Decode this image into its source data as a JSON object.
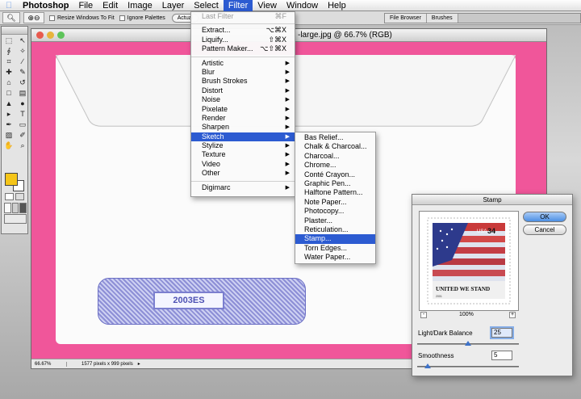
{
  "menubar": {
    "app": "Photoshop",
    "items": [
      "File",
      "Edit",
      "Image",
      "Layer",
      "Select",
      "Filter",
      "View",
      "Window",
      "Help"
    ],
    "active": "Filter"
  },
  "options": {
    "chk1": "Resize Windows To Fit",
    "chk2": "Ignore Palettes",
    "pill1": "Actual",
    "tabs": [
      "File Browser",
      "Brushes"
    ]
  },
  "toolbox": {
    "foreground": "#f5c518",
    "background": "#ffffff"
  },
  "document": {
    "title": "-large.jpg @ 66.7% (RGB)",
    "zoom": "66.67%",
    "size": "1577 pixels x 999 pixels",
    "canvas_color": "#f0569a",
    "envelope_code": "2003ES"
  },
  "filter_menu": {
    "items": [
      {
        "label": "Last Filter",
        "shortcut": "⌘F",
        "disabled": true
      },
      {
        "sep": true
      },
      {
        "label": "Extract...",
        "shortcut": "⌥⌘X"
      },
      {
        "label": "Liquify...",
        "shortcut": "⇧⌘X"
      },
      {
        "label": "Pattern Maker...",
        "shortcut": "⌥⇧⌘X"
      },
      {
        "sep": true
      },
      {
        "label": "Artistic",
        "sub": true
      },
      {
        "label": "Blur",
        "sub": true
      },
      {
        "label": "Brush Strokes",
        "sub": true
      },
      {
        "label": "Distort",
        "sub": true
      },
      {
        "label": "Noise",
        "sub": true
      },
      {
        "label": "Pixelate",
        "sub": true
      },
      {
        "label": "Render",
        "sub": true
      },
      {
        "label": "Sharpen",
        "sub": true
      },
      {
        "label": "Sketch",
        "sub": true,
        "highlight": true
      },
      {
        "label": "Stylize",
        "sub": true
      },
      {
        "label": "Texture",
        "sub": true
      },
      {
        "label": "Video",
        "sub": true
      },
      {
        "label": "Other",
        "sub": true
      },
      {
        "sep": true
      },
      {
        "label": "Digimarc",
        "sub": true
      }
    ]
  },
  "sketch_menu": {
    "items": [
      "Bas Relief...",
      "Chalk & Charcoal...",
      "Charcoal...",
      "Chrome...",
      "Conté Crayon...",
      "Graphic Pen...",
      "Halftone Pattern...",
      "Note Paper...",
      "Photocopy...",
      "Plaster...",
      "Reticulation...",
      "Stamp...",
      "Torn Edges...",
      "Water Paper..."
    ],
    "highlighted": "Stamp..."
  },
  "dialog": {
    "title": "Stamp",
    "ok": "OK",
    "cancel": "Cancel",
    "zoom": "100%",
    "zoom_minus": "-",
    "zoom_plus": "+",
    "light_dark_label": "Light/Dark Balance",
    "light_dark_value": "25",
    "light_dark_max": 50,
    "smoothness_label": "Smoothness",
    "smoothness_value": "5",
    "smoothness_max": 50,
    "stamp_text": "UNITED WE STAND",
    "stamp_country": "USA",
    "stamp_value": "34",
    "stamp_year": "2001"
  }
}
